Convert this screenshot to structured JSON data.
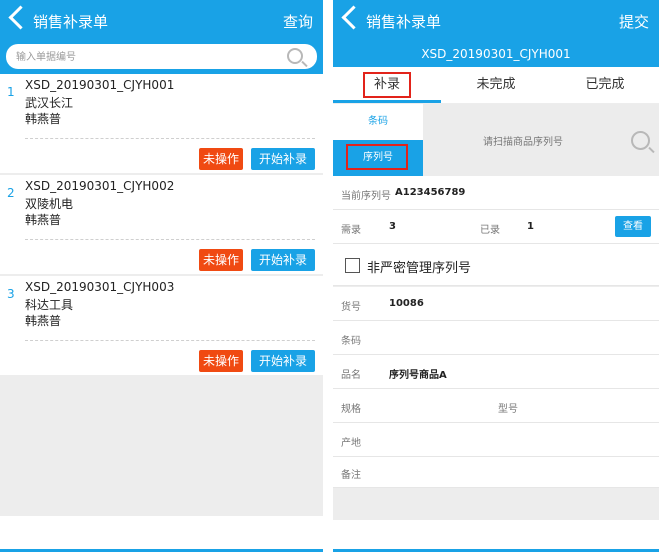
{
  "left": {
    "title": "销售补录单",
    "action": "查询",
    "search_placeholder": "输入单据编号",
    "orders": [
      {
        "index": "1",
        "code": "XSD_20190301_CJYH001",
        "company": "武汉长江",
        "person": "韩燕普",
        "status": "未操作",
        "action": "开始补录"
      },
      {
        "index": "2",
        "code": "XSD_20190301_CJYH002",
        "company": "双陵机电",
        "person": "韩燕普",
        "status": "未操作",
        "action": "开始补录"
      },
      {
        "index": "3",
        "code": "XSD_20190301_CJYH003",
        "company": "科达工具",
        "person": "韩燕普",
        "status": "未操作",
        "action": "开始补录"
      }
    ]
  },
  "right": {
    "title": "销售补录单",
    "action": "提交",
    "order_code": "XSD_20190301_CJYH001",
    "tabs": [
      "补录",
      "未完成",
      "已完成"
    ],
    "scan_options": [
      "条码",
      "序列号"
    ],
    "scan_hint": "请扫描商品序列号",
    "current_serial_label": "当前序列号",
    "current_serial": "A123456789",
    "need_label": "需录",
    "need_value": "3",
    "done_label": "已录",
    "done_value": "1",
    "view_button": "查看",
    "nonsecret_label": "非严密管理序列号",
    "fields": {
      "huohao_label": "货号",
      "huohao_value": "10086",
      "barcode_label": "条码",
      "barcode_value": "",
      "pinming_label": "品名",
      "pinming_value": "序列号商品A",
      "guige_label": "规格",
      "guige_value": "",
      "xinghao_label": "型号",
      "xinghao_value": "",
      "chandi_label": "产地",
      "chandi_value": "",
      "beizhu_label": "备注",
      "beizhu_value": ""
    }
  },
  "colors": {
    "brand": "#19a2e6",
    "status_red": "#f04a12",
    "highlight_box": "#e2231a"
  }
}
